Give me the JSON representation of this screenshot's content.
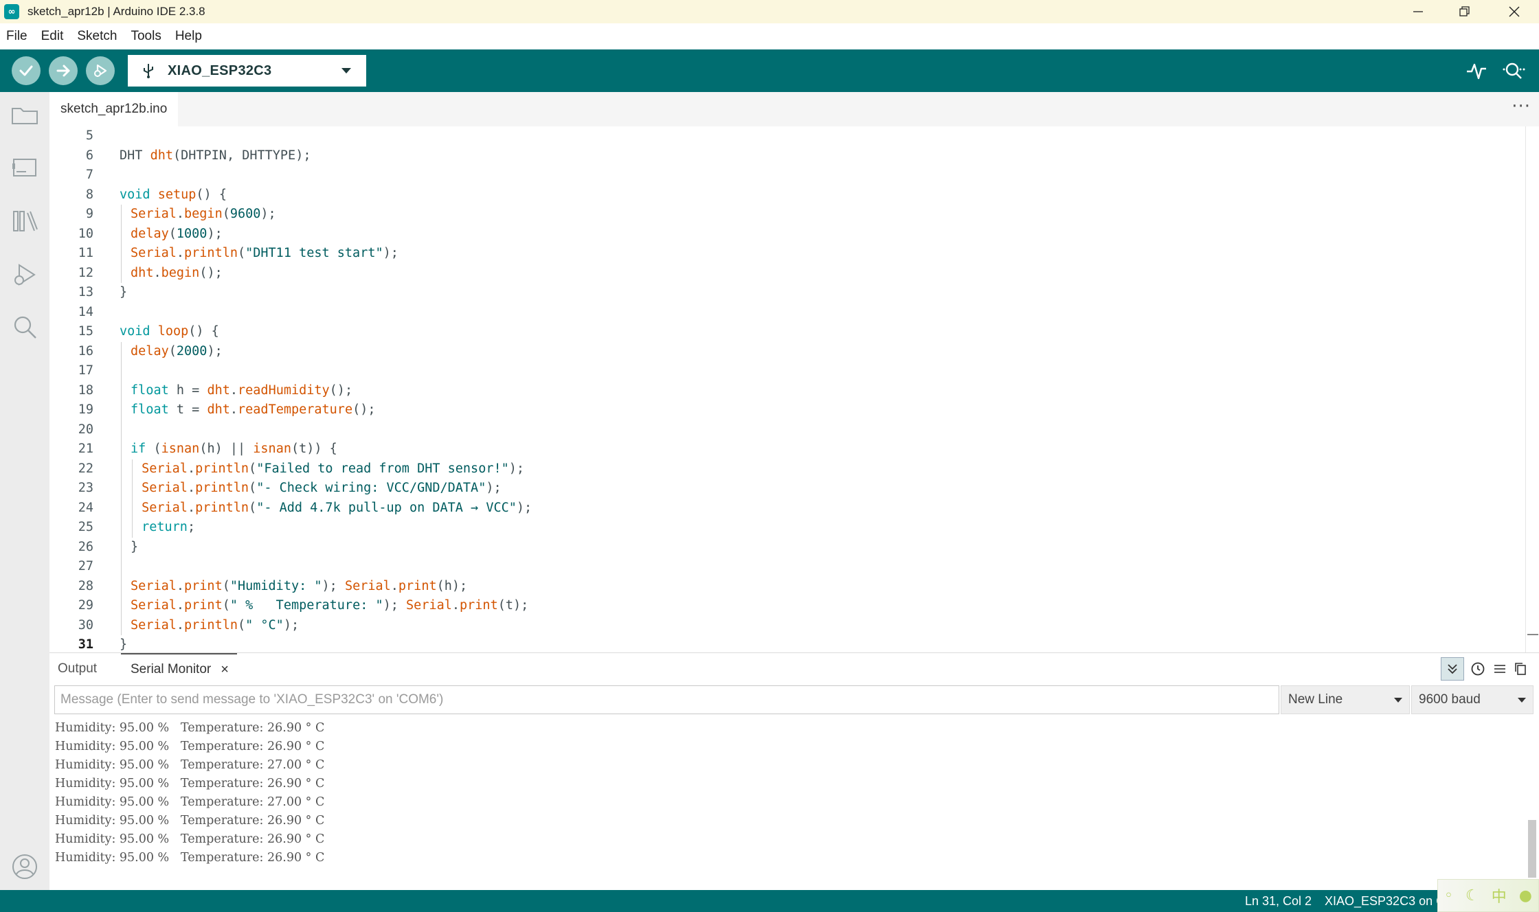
{
  "window": {
    "title": "sketch_apr12b | Arduino IDE 2.3.8",
    "app_icon_glyph": "∞"
  },
  "menu": [
    "File",
    "Edit",
    "Sketch",
    "Tools",
    "Help"
  ],
  "toolbar": {
    "board": "XIAO_ESP32C3",
    "accent_color": "#006d70",
    "button_color": "#93c8c6"
  },
  "editor": {
    "tab": "sketch_apr12b.ino",
    "more_glyph": "···",
    "active_line": 31,
    "lines": [
      {
        "n": 5,
        "indent": 0,
        "tokens": []
      },
      {
        "n": 6,
        "indent": 0,
        "tokens": [
          [
            "",
            "DHT "
          ],
          [
            "fn",
            "dht"
          ],
          [
            "",
            "(DHTPIN, DHTTYPE);"
          ]
        ]
      },
      {
        "n": 7,
        "indent": 0,
        "tokens": []
      },
      {
        "n": 8,
        "indent": 0,
        "tokens": [
          [
            "kw",
            "void"
          ],
          [
            "",
            " "
          ],
          [
            "fn",
            "setup"
          ],
          [
            "",
            "() {"
          ]
        ]
      },
      {
        "n": 9,
        "indent": 1,
        "tokens": [
          [
            "fn",
            "Serial"
          ],
          [
            "",
            "."
          ],
          [
            "fn",
            "begin"
          ],
          [
            "",
            "("
          ],
          [
            "num",
            "9600"
          ],
          [
            "",
            ");"
          ]
        ]
      },
      {
        "n": 10,
        "indent": 1,
        "tokens": [
          [
            "fn",
            "delay"
          ],
          [
            "",
            "("
          ],
          [
            "num",
            "1000"
          ],
          [
            "",
            ");"
          ]
        ]
      },
      {
        "n": 11,
        "indent": 1,
        "tokens": [
          [
            "fn",
            "Serial"
          ],
          [
            "",
            "."
          ],
          [
            "fn",
            "println"
          ],
          [
            "",
            "("
          ],
          [
            "str",
            "\"DHT11 test start\""
          ],
          [
            "",
            ");"
          ]
        ]
      },
      {
        "n": 12,
        "indent": 1,
        "tokens": [
          [
            "fn",
            "dht"
          ],
          [
            "",
            "."
          ],
          [
            "fn",
            "begin"
          ],
          [
            "",
            "();"
          ]
        ]
      },
      {
        "n": 13,
        "indent": 0,
        "tokens": [
          [
            "",
            "}"
          ]
        ]
      },
      {
        "n": 14,
        "indent": 0,
        "tokens": []
      },
      {
        "n": 15,
        "indent": 0,
        "tokens": [
          [
            "kw",
            "void"
          ],
          [
            "",
            " "
          ],
          [
            "fn",
            "loop"
          ],
          [
            "",
            "() {"
          ]
        ]
      },
      {
        "n": 16,
        "indent": 1,
        "tokens": [
          [
            "fn",
            "delay"
          ],
          [
            "",
            "("
          ],
          [
            "num",
            "2000"
          ],
          [
            "",
            ");"
          ]
        ]
      },
      {
        "n": 17,
        "indent": 1,
        "tokens": []
      },
      {
        "n": 18,
        "indent": 1,
        "tokens": [
          [
            "ty",
            "float"
          ],
          [
            "",
            " h = "
          ],
          [
            "fn",
            "dht"
          ],
          [
            "",
            "."
          ],
          [
            "fn",
            "readHumidity"
          ],
          [
            "",
            "();"
          ]
        ]
      },
      {
        "n": 19,
        "indent": 1,
        "tokens": [
          [
            "ty",
            "float"
          ],
          [
            "",
            " t = "
          ],
          [
            "fn",
            "dht"
          ],
          [
            "",
            "."
          ],
          [
            "fn",
            "readTemperature"
          ],
          [
            "",
            "();"
          ]
        ]
      },
      {
        "n": 20,
        "indent": 1,
        "tokens": []
      },
      {
        "n": 21,
        "indent": 1,
        "tokens": [
          [
            "kw",
            "if"
          ],
          [
            "",
            " ("
          ],
          [
            "fn",
            "isnan"
          ],
          [
            "",
            "(h) || "
          ],
          [
            "fn",
            "isnan"
          ],
          [
            "",
            "(t)) {"
          ]
        ]
      },
      {
        "n": 22,
        "indent": 2,
        "tokens": [
          [
            "fn",
            "Serial"
          ],
          [
            "",
            "."
          ],
          [
            "fn",
            "println"
          ],
          [
            "",
            "("
          ],
          [
            "str",
            "\"Failed to read from DHT sensor!\""
          ],
          [
            "",
            ");"
          ]
        ]
      },
      {
        "n": 23,
        "indent": 2,
        "tokens": [
          [
            "fn",
            "Serial"
          ],
          [
            "",
            "."
          ],
          [
            "fn",
            "println"
          ],
          [
            "",
            "("
          ],
          [
            "str",
            "\"- Check wiring: VCC/GND/DATA\""
          ],
          [
            "",
            ");"
          ]
        ]
      },
      {
        "n": 24,
        "indent": 2,
        "tokens": [
          [
            "fn",
            "Serial"
          ],
          [
            "",
            "."
          ],
          [
            "fn",
            "println"
          ],
          [
            "",
            "("
          ],
          [
            "str",
            "\"- Add 4.7k pull-up on DATA → VCC\""
          ],
          [
            "",
            ");"
          ]
        ]
      },
      {
        "n": 25,
        "indent": 2,
        "tokens": [
          [
            "kw",
            "return"
          ],
          [
            "",
            ";"
          ]
        ]
      },
      {
        "n": 26,
        "indent": 1,
        "tokens": [
          [
            "",
            "}"
          ]
        ]
      },
      {
        "n": 27,
        "indent": 1,
        "tokens": []
      },
      {
        "n": 28,
        "indent": 1,
        "tokens": [
          [
            "fn",
            "Serial"
          ],
          [
            "",
            "."
          ],
          [
            "fn",
            "print"
          ],
          [
            "",
            "("
          ],
          [
            "str",
            "\"Humidity: \""
          ],
          [
            "",
            "); "
          ],
          [
            "fn",
            "Serial"
          ],
          [
            "",
            "."
          ],
          [
            "fn",
            "print"
          ],
          [
            "",
            "(h);"
          ]
        ]
      },
      {
        "n": 29,
        "indent": 1,
        "tokens": [
          [
            "fn",
            "Serial"
          ],
          [
            "",
            "."
          ],
          [
            "fn",
            "print"
          ],
          [
            "",
            "("
          ],
          [
            "str",
            "\" %   Temperature: \""
          ],
          [
            "",
            "); "
          ],
          [
            "fn",
            "Serial"
          ],
          [
            "",
            "."
          ],
          [
            "fn",
            "print"
          ],
          [
            "",
            "(t);"
          ]
        ]
      },
      {
        "n": 30,
        "indent": 1,
        "tokens": [
          [
            "fn",
            "Serial"
          ],
          [
            "",
            "."
          ],
          [
            "fn",
            "println"
          ],
          [
            "",
            "("
          ],
          [
            "str",
            "\" °C\""
          ],
          [
            "",
            ");"
          ]
        ]
      },
      {
        "n": 31,
        "indent": 0,
        "tokens": [
          [
            "",
            "}"
          ]
        ]
      }
    ]
  },
  "panel": {
    "tabs": {
      "output": "Output",
      "serial": "Serial Monitor",
      "close_glyph": "×"
    },
    "message_placeholder": "Message (Enter to send message to 'XIAO_ESP32C3' on 'COM6')",
    "line_ending": "New Line",
    "baud": "9600 baud",
    "serial_lines": [
      "Humidity: 95.00 %   Temperature: 26.90 ° C",
      "Humidity: 95.00 %   Temperature: 26.90 ° C",
      "Humidity: 95.00 %   Temperature: 27.00 ° C",
      "Humidity: 95.00 %   Temperature: 26.90 ° C",
      "Humidity: 95.00 %   Temperature: 27.00 ° C",
      "Humidity: 95.00 %   Temperature: 26.90 ° C",
      "Humidity: 95.00 %   Temperature: 26.90 ° C",
      "Humidity: 95.00 %   Temperature: 26.90 ° C"
    ]
  },
  "status": {
    "cursor": "Ln 31, Col 2",
    "board_port": "XIAO_ESP32C3 on CO"
  },
  "ime": {
    "glyph_chinese": "中"
  }
}
